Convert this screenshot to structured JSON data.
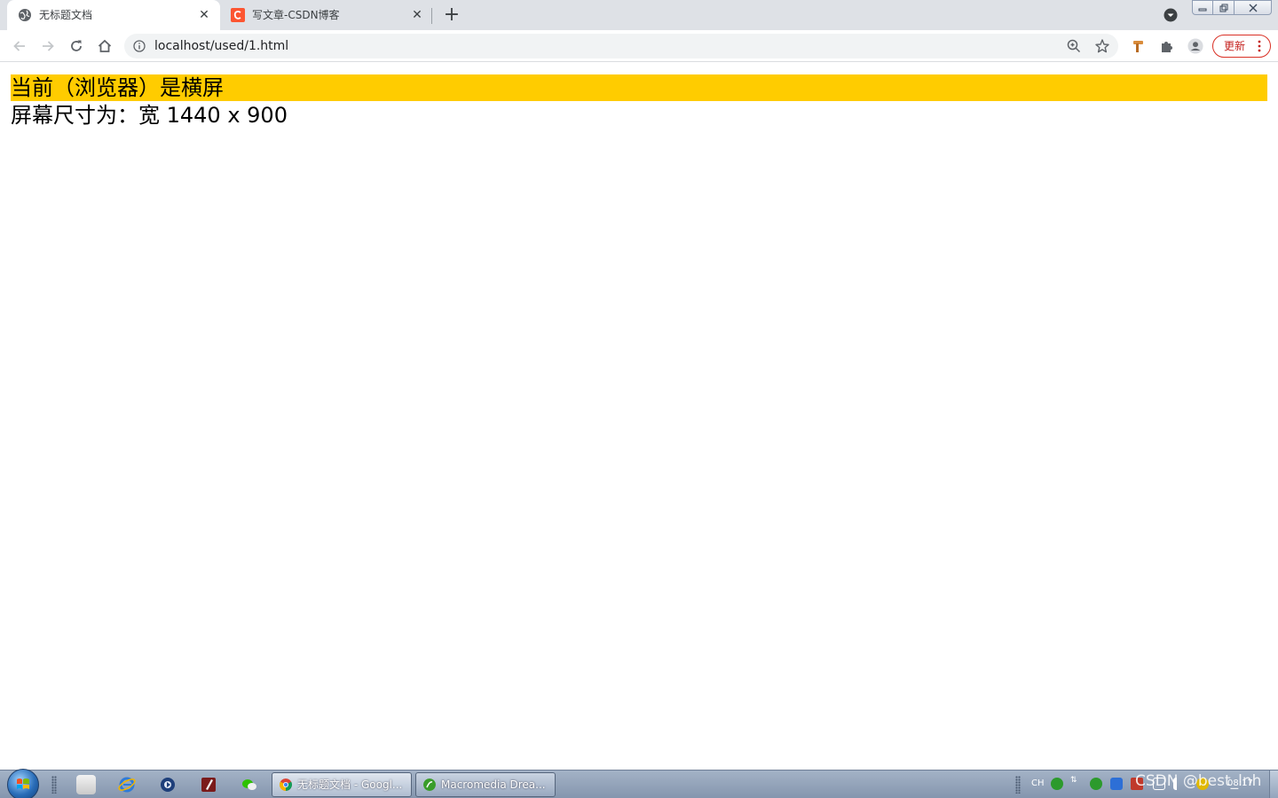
{
  "browser": {
    "tabs": [
      {
        "title": "无标题文档",
        "active": true
      },
      {
        "title": "写文章-CSDN博客",
        "active": false
      }
    ],
    "address": {
      "url": "localhost/used/1.html"
    },
    "update_label": "更新",
    "accent_update": "#d93025"
  },
  "page": {
    "orientation_text": "当前（浏览器）是横屏",
    "size_text": "屏幕尺寸为：宽 1440 x 900",
    "highlight_color": "#ffcc00"
  },
  "taskbar": {
    "tasks": [
      {
        "label": "无标题文档 - Googl..."
      },
      {
        "label": "Macromedia Drea..."
      }
    ],
    "tray": {
      "ime": "CH",
      "watermark": "CSDN @best_lnh",
      "clock": "08:17"
    }
  }
}
